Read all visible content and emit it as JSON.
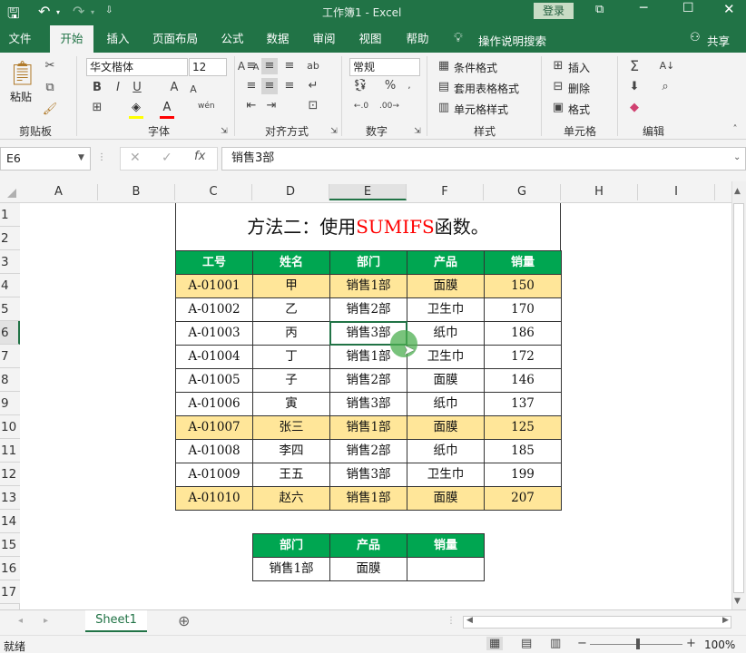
{
  "titlebar": {
    "title": "工作簿1  -  Excel",
    "login": "登录"
  },
  "tabs": [
    "文件",
    "开始",
    "插入",
    "页面布局",
    "公式",
    "数据",
    "审阅",
    "视图",
    "帮助"
  ],
  "tell_me": "操作说明搜索",
  "share": "共享",
  "ribbon": {
    "paste": "粘贴",
    "font_name": "华文楷体",
    "font_size": "12",
    "number_format": "常规",
    "cond_format": "条件格式",
    "table_format": "套用表格格式",
    "cell_style": "单元格样式",
    "insert": "插入",
    "delete": "删除",
    "format": "格式",
    "groups": [
      "剪贴板",
      "字体",
      "对齐方式",
      "数字",
      "样式",
      "单元格",
      "编辑"
    ]
  },
  "formula_bar": {
    "name_box": "E6",
    "content": "销售3部"
  },
  "columns": [
    "A",
    "B",
    "C",
    "D",
    "E",
    "F",
    "G",
    "H",
    "I"
  ],
  "rows": [
    "1",
    "2",
    "3",
    "4",
    "5",
    "6",
    "7",
    "8",
    "9",
    "10",
    "11",
    "12",
    "13",
    "14",
    "15",
    "16",
    "17"
  ],
  "title": {
    "prefix": "方法二：使用",
    "highlight": "SUMIFS",
    "suffix": "函数。"
  },
  "table": {
    "headers": [
      "工号",
      "姓名",
      "部门",
      "产品",
      "销量"
    ],
    "rows": [
      [
        "A-01001",
        "甲",
        "销售1部",
        "面膜",
        "150"
      ],
      [
        "A-01002",
        "乙",
        "销售2部",
        "卫生巾",
        "170"
      ],
      [
        "A-01003",
        "丙",
        "销售3部",
        "纸巾",
        "186"
      ],
      [
        "A-01004",
        "丁",
        "销售1部",
        "卫生巾",
        "172"
      ],
      [
        "A-01005",
        "子",
        "销售2部",
        "面膜",
        "146"
      ],
      [
        "A-01006",
        "寅",
        "销售3部",
        "纸巾",
        "137"
      ],
      [
        "A-01007",
        "张三",
        "销售1部",
        "面膜",
        "125"
      ],
      [
        "A-01008",
        "李四",
        "销售2部",
        "纸巾",
        "185"
      ],
      [
        "A-01009",
        "王五",
        "销售3部",
        "卫生巾",
        "199"
      ],
      [
        "A-01010",
        "赵六",
        "销售1部",
        "面膜",
        "207"
      ]
    ],
    "highlight_rows": [
      0,
      6,
      9
    ]
  },
  "criteria": {
    "headers": [
      "部门",
      "产品",
      "销量"
    ],
    "values": [
      "销售1部",
      "面膜",
      ""
    ]
  },
  "sheet_tab": "Sheet1",
  "status": {
    "ready": "就绪",
    "zoom": "100%"
  },
  "colors": {
    "excel_green": "#217346",
    "header_green": "#00a651",
    "highlight_yellow": "#ffe699",
    "title_red": "#ff0000"
  }
}
